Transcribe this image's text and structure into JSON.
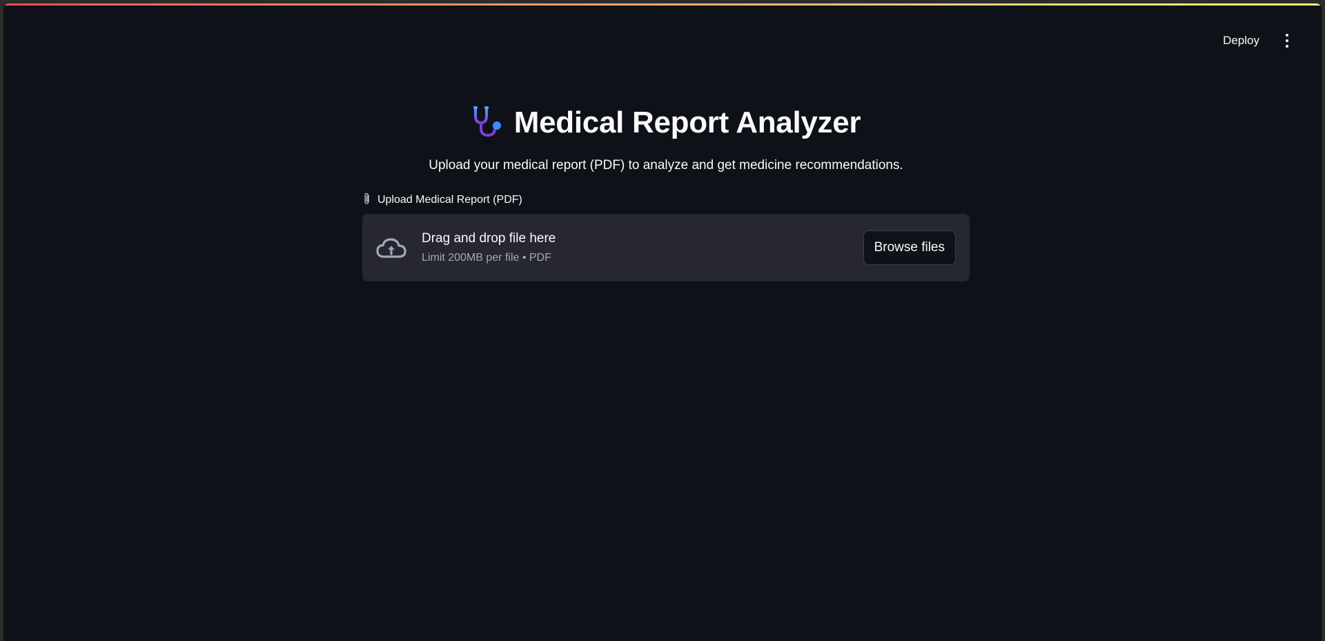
{
  "header": {
    "deploy_label": "Deploy",
    "menu_icon": "vertical-ellipsis-icon"
  },
  "main": {
    "title_icon": "stethoscope-icon",
    "title": "Medical Report Analyzer",
    "subtitle": "Upload your medical report (PDF) to analyze and get medicine recommendations."
  },
  "uploader": {
    "label_icon": "paperclip-icon",
    "label": "Upload Medical Report (PDF)",
    "drop_icon": "cloud-upload-icon",
    "drop_title": "Drag and drop file here",
    "drop_hint": "Limit 200MB per file • PDF",
    "browse_label": "Browse files"
  },
  "colors": {
    "background": "#0e1117",
    "dropzone": "#262730",
    "text": "#fafafa",
    "hint": "#a3a8b8",
    "accent_gradient_start": "#ff4b4b",
    "accent_gradient_end": "#fffd80"
  }
}
